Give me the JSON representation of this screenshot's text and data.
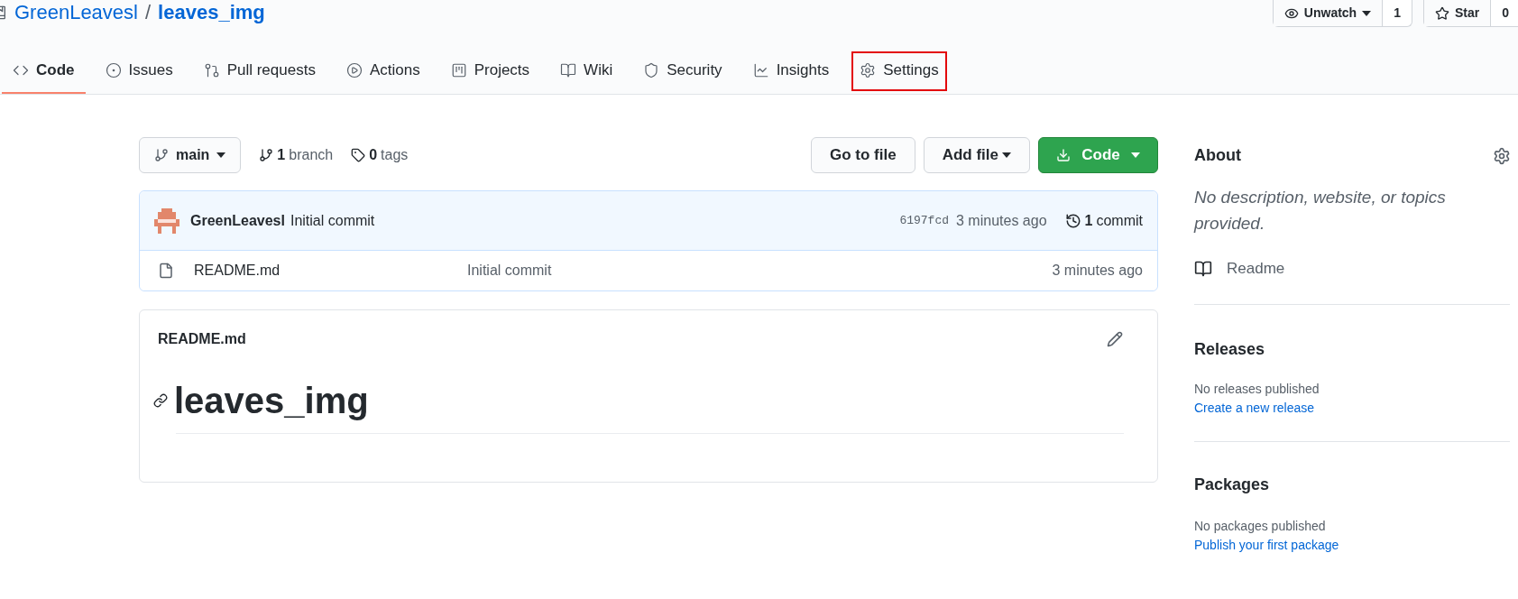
{
  "repo": {
    "owner": "GreenLeavesl",
    "separator": "/",
    "name": "leaves_img"
  },
  "watch": {
    "label": "Unwatch",
    "count": "1"
  },
  "star": {
    "label": "Star",
    "count": "0"
  },
  "tabs": [
    {
      "kind": "code",
      "label": "Code",
      "selected": true,
      "highlighted": false
    },
    {
      "kind": "issues",
      "label": "Issues",
      "selected": false,
      "highlighted": false
    },
    {
      "kind": "pulls",
      "label": "Pull requests",
      "selected": false,
      "highlighted": false
    },
    {
      "kind": "actions",
      "label": "Actions",
      "selected": false,
      "highlighted": false
    },
    {
      "kind": "projects",
      "label": "Projects",
      "selected": false,
      "highlighted": false
    },
    {
      "kind": "wiki",
      "label": "Wiki",
      "selected": false,
      "highlighted": false
    },
    {
      "kind": "security",
      "label": "Security",
      "selected": false,
      "highlighted": false
    },
    {
      "kind": "insights",
      "label": "Insights",
      "selected": false,
      "highlighted": false
    },
    {
      "kind": "settings",
      "label": "Settings",
      "selected": false,
      "highlighted": true
    }
  ],
  "branch_button": {
    "label": "main"
  },
  "branches": {
    "count": "1",
    "label": "branch"
  },
  "tags": {
    "count": "0",
    "label": "tags"
  },
  "go_to_file": "Go to file",
  "add_file": "Add file",
  "code_button": "Code",
  "commit": {
    "author": "GreenLeavesl",
    "message": "Initial commit",
    "hash": "6197fcd",
    "time": "3 minutes ago",
    "count": "1",
    "count_label": "commit"
  },
  "files": [
    {
      "name": "README.md",
      "message": "Initial commit",
      "time": "3 minutes ago"
    }
  ],
  "readme": {
    "filename": "README.md",
    "heading": "leaves_img"
  },
  "about": {
    "title": "About",
    "description": "No description, website, or topics provided.",
    "readme_link": "Readme"
  },
  "releases": {
    "title": "Releases",
    "empty": "No releases published",
    "link": "Create a new release"
  },
  "packages": {
    "title": "Packages",
    "empty": "No packages published",
    "link": "Publish your first package"
  }
}
